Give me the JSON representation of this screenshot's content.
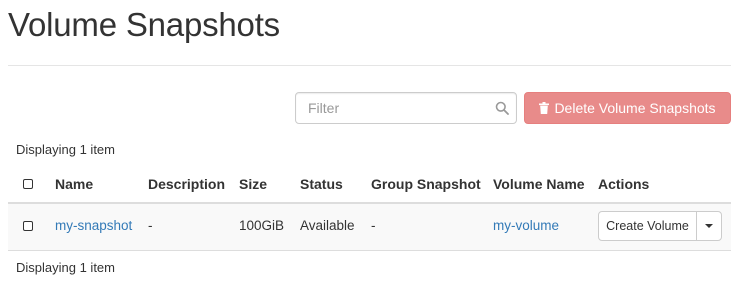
{
  "page": {
    "title": "Volume Snapshots"
  },
  "toolbar": {
    "filter_placeholder": "Filter",
    "delete_label": "Delete Volume Snapshots",
    "delete_color": "#e88b8a"
  },
  "table": {
    "count_top": "Displaying 1 item",
    "count_bottom": "Displaying 1 item",
    "columns": [
      "Name",
      "Description",
      "Size",
      "Status",
      "Group Snapshot",
      "Volume Name",
      "Actions"
    ],
    "rows": [
      {
        "name": "my-snapshot",
        "description": "-",
        "size": "100GiB",
        "status": "Available",
        "group_snapshot": "-",
        "volume_name": "my-volume",
        "action_label": "Create Volume"
      }
    ]
  },
  "colors": {
    "link": "#337ab7",
    "text": "#333333"
  },
  "icons": {
    "search": "search-icon",
    "delete": "trash-icon",
    "dropdown": "caret-down-icon"
  }
}
